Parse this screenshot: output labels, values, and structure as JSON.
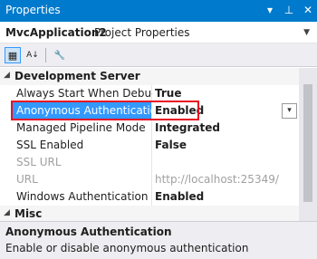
{
  "window": {
    "title": "Properties"
  },
  "titlebar_icons": {
    "dropdown": "▾",
    "pin": "⊥",
    "close": "✕"
  },
  "object_selector": {
    "name": "MvcApplication2",
    "type": "Project Properties",
    "arrow": "▼"
  },
  "toolbar": {
    "categorized_icon": "▦",
    "alphabetical_icon": "A↓",
    "property_pages_icon": "🔧"
  },
  "grid": {
    "category": {
      "toggle": "◢",
      "label": "Development Server"
    },
    "rows": [
      {
        "name": "Always Start When Debuggi",
        "value": "True"
      },
      {
        "name": "Anonymous Authentication",
        "value": "Enabled",
        "dropdown": "▾"
      },
      {
        "name": "Managed Pipeline Mode",
        "value": "Integrated"
      },
      {
        "name": "SSL Enabled",
        "value": "False"
      },
      {
        "name": "SSL URL",
        "value": ""
      },
      {
        "name": "URL",
        "value": "http://localhost:25349/"
      },
      {
        "name": "Windows Authentication",
        "value": "Enabled"
      }
    ],
    "next_category": {
      "toggle": "◢",
      "label": "Misc"
    }
  },
  "description": {
    "title": "Anonymous Authentication",
    "text": "Enable or disable anonymous authentication"
  },
  "colors": {
    "accent": "#007acc",
    "selection": "#3399ff",
    "highlight_box": "#e81123"
  }
}
